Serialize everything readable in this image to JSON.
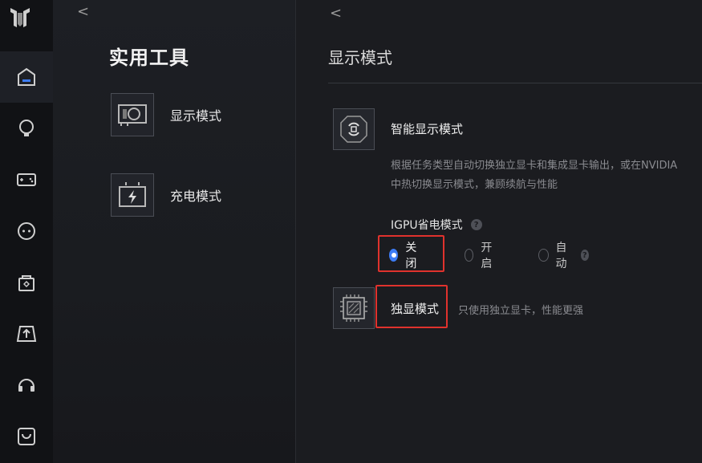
{
  "sidebar": {
    "logo": "brand-logo-icon",
    "items": [
      {
        "icon": "home-icon",
        "active": true
      },
      {
        "icon": "lightbulb-icon",
        "active": false
      },
      {
        "icon": "gamepad-icon",
        "active": false
      },
      {
        "icon": "chat-bot-icon",
        "active": false
      },
      {
        "icon": "package-icon",
        "active": false
      },
      {
        "icon": "upload-icon",
        "active": false
      },
      {
        "icon": "headset-icon",
        "active": false
      },
      {
        "icon": "shopping-bag-icon",
        "active": false
      }
    ]
  },
  "middle": {
    "back": "<",
    "title": "实用工具",
    "tools": [
      {
        "label": "显示模式",
        "icon": "graphics-card-icon"
      },
      {
        "label": "充电模式",
        "icon": "battery-charge-icon"
      }
    ]
  },
  "main": {
    "back": "<",
    "title": "显示模式",
    "smart_mode": {
      "title": "智能显示模式",
      "description_line1": "根据任务类型自动切换独立显卡和集成显卡输出，或在NVIDIA",
      "description_line2": "中热切换显示模式，兼顾续航与性能",
      "igpu_label": "IGPU省电模式",
      "help": "?",
      "options": [
        {
          "label": "关闭",
          "checked": true
        },
        {
          "label": "开启",
          "checked": false
        },
        {
          "label": "自动",
          "checked": false
        }
      ]
    },
    "dgpu_mode": {
      "title": "独显模式",
      "description": "只使用独立显卡，性能更强"
    }
  },
  "colors": {
    "accent": "#3d7cf5",
    "highlight": "#e0322d",
    "background": "#1b1c20"
  }
}
